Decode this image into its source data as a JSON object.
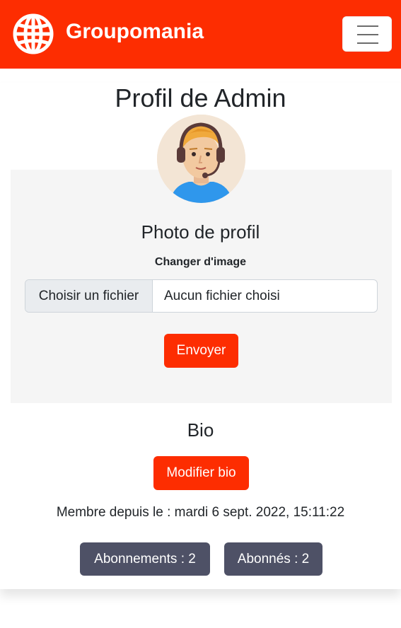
{
  "navbar": {
    "brand_name": "Groupomania",
    "brand_icon": "globe-icon",
    "toggler_icon": "hamburger-menu-icon",
    "background_color": "#fd2d01"
  },
  "profile": {
    "title": "Profil de Admin",
    "avatar": "support-agent-avatar"
  },
  "photo_section": {
    "heading": "Photo de profil",
    "change_label": "Changer d'image",
    "file_button_label": "Choisir un fichier",
    "file_status": "Aucun fichier choisi",
    "submit_label": "Envoyer"
  },
  "bio_section": {
    "heading": "Bio",
    "edit_label": "Modifier bio"
  },
  "member_since": "Membre depuis le : mardi 6 sept. 2022, 15:11:22",
  "stats": {
    "subscriptions_label": "Abonnements : 2",
    "followers_label": "Abonnés : 2"
  },
  "colors": {
    "accent": "#fd2d01",
    "secondary": "#4e5166",
    "panel": "#f5f5f5"
  }
}
